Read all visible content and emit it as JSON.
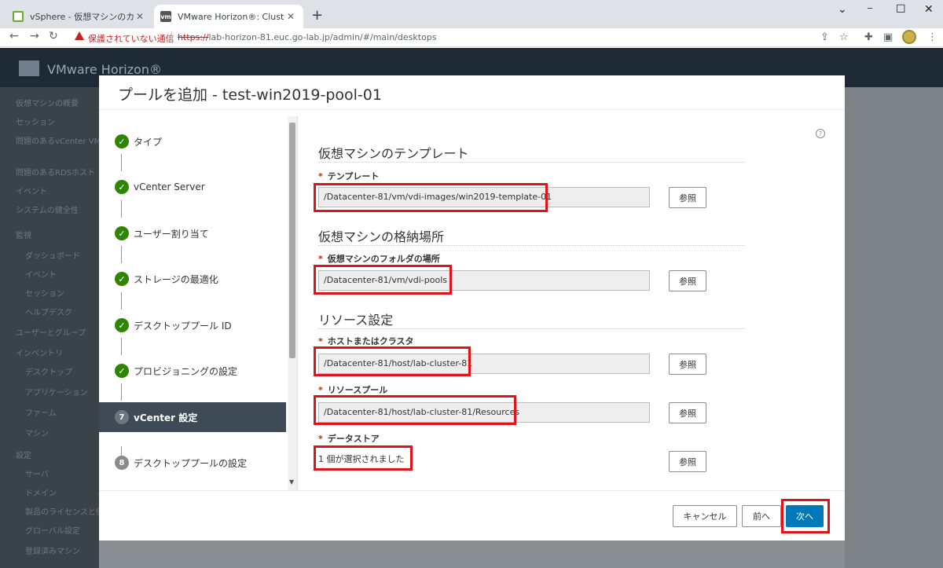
{
  "browser": {
    "tabs": [
      {
        "title": "vSphere - 仮想マシンのカスタマイズ仕様",
        "favicon": "vsphere-icon",
        "close": "✕"
      },
      {
        "title": "VMware Horizon®: Cluster-LAB-H",
        "favicon": "vm",
        "close": "✕"
      }
    ],
    "new_tab": "+",
    "security_warning": "保護されていない通信",
    "url_scheme": "https://",
    "url_rest": "lab-horizon-81.euc.go-lab.jp/admin/#/main/desktops",
    "window_controls": {
      "minimize": "─",
      "maximize": "☐",
      "close": "✕",
      "chevron": "⌄"
    }
  },
  "app": {
    "title": "VMware Horizon®",
    "sidebar_items": [
      "仮想マシンの概要",
      "セッション",
      "問題のあるvCenter VM",
      "問題のあるRDSホスト",
      "イベント",
      "システムの健全性",
      "監視",
      "ダッシュボード",
      "イベント",
      "セッション",
      "ヘルプデスク",
      "ユーザーとグループ",
      "インベントリ",
      "デスクトップ",
      "アプリケーション",
      "ファーム",
      "マシン",
      "設定",
      "サーバ",
      "ドメイン",
      "製品のライセンスと使用状況",
      "グローバル設定",
      "登録済みマシン"
    ]
  },
  "modal": {
    "title": "プールを追加 - test-win2019-pool-01",
    "help": "?",
    "steps": [
      {
        "label": "タイプ",
        "state": "done"
      },
      {
        "label": "vCenter Server",
        "state": "done"
      },
      {
        "label": "ユーザー割り当て",
        "state": "done"
      },
      {
        "label": "ストレージの最適化",
        "state": "done"
      },
      {
        "label": "デスクトッププール ID",
        "state": "done"
      },
      {
        "label": "プロビジョニングの設定",
        "state": "done"
      },
      {
        "label": "vCenter 設定",
        "state": "active",
        "number": "7"
      },
      {
        "label": "デスクトッププールの設定",
        "state": "pending",
        "number": "8"
      }
    ],
    "check_mark": "✓",
    "sections": {
      "vm_template": {
        "heading": "仮想マシンのテンプレート",
        "template_label": "テンプレート",
        "template_value": "/Datacenter-81/vm/vdi-images/win2019-template-01"
      },
      "vm_location": {
        "heading": "仮想マシンの格納場所",
        "folder_label": "仮想マシンのフォルダの場所",
        "folder_value": "/Datacenter-81/vm/vdi-pools"
      },
      "resources": {
        "heading": "リソース設定",
        "host_label": "ホストまたはクラスタ",
        "host_value": "/Datacenter-81/host/lab-cluster-81",
        "pool_label": "リソースプール",
        "pool_value": "/Datacenter-81/host/lab-cluster-81/Resources",
        "datastore_label": "データストア",
        "datastore_value": "1 個が選択されました"
      }
    },
    "required_mark": "*",
    "browse_label": "参照",
    "buttons": {
      "cancel": "キャンセル",
      "back": "前へ",
      "next": "次へ"
    }
  }
}
